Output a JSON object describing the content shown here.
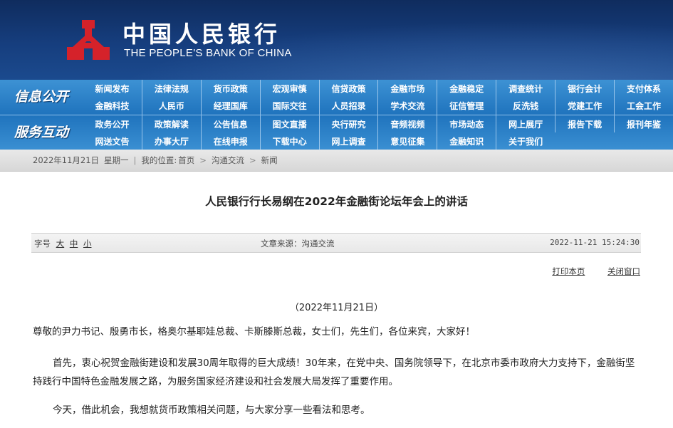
{
  "header": {
    "logo_cn": "中国人民银行",
    "logo_en": "THE PEOPLE'S BANK OF CHINA",
    "emblem_icon": "pboc-emblem-icon",
    "brand_red": "#d5222a"
  },
  "nav": {
    "section1": {
      "title": "信息公开",
      "items": [
        "新闻发布",
        "法律法规",
        "货币政策",
        "宏观审慎",
        "信贷政策",
        "金融市场",
        "金融稳定",
        "调查统计",
        "银行会计",
        "支付体系",
        "金融科技",
        "人民币",
        "经理国库",
        "国际交往",
        "人员招录",
        "学术交流",
        "征信管理",
        "反洗钱",
        "党建工作",
        "工会工作"
      ]
    },
    "section2": {
      "title": "服务互动",
      "items": [
        "政务公开",
        "政策解读",
        "公告信息",
        "图文直播",
        "央行研究",
        "音频视频",
        "市场动态",
        "网上展厅",
        "报告下载",
        "报刊年鉴",
        "网送文告",
        "办事大厅",
        "在线申报",
        "下载中心",
        "网上调查",
        "意见征集",
        "金融知识",
        "关于我们"
      ]
    }
  },
  "breadcrumb": {
    "date": "2022年11月21日",
    "weekday": "星期一",
    "location_label": "我的位置:",
    "home": "首页",
    "level1": "沟通交流",
    "level2": "新闻"
  },
  "article": {
    "title": "人民银行行长易纲在2022年金融街论坛年会上的讲话",
    "font_size_label": "字号",
    "font_large": "大",
    "font_medium": "中",
    "font_small": "小",
    "source": "文章来源：沟通交流",
    "datetime": "2022-11-21 15:24:30",
    "print_label": "打印本页",
    "close_label": "关闭窗口",
    "date_line": "（2022年11月21日）",
    "paragraphs": [
      "尊敬的尹力书记、殷勇市长，格奥尔基耶娃总裁、卡斯滕斯总裁，女士们，先生们，各位来宾，大家好！",
      "首先，衷心祝贺金融街建设和发展30周年取得的巨大成绩！30年来，在党中央、国务院领导下，在北京市委市政府大力支持下，金融街坚持践行中国特色金融发展之路，为服务国家经济建设和社会发展大局发挥了重要作用。",
      "今天，借此机会，我想就货币政策相关问题，与大家分享一些看法和思考。"
    ]
  }
}
